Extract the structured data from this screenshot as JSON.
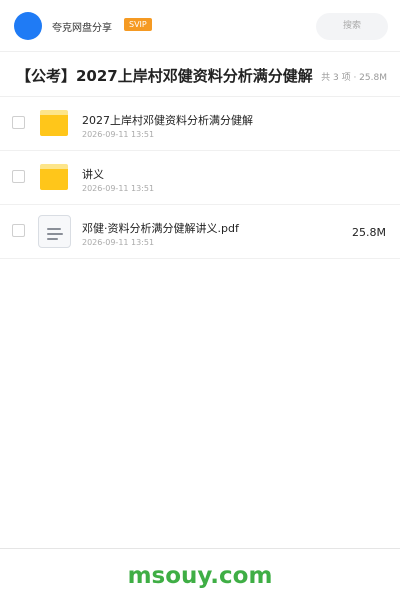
{
  "header": {
    "app_name": "夸克网盘分享",
    "badge": "SVIP",
    "search_placeholder": "搜索",
    "avatar_color": "#1f7bf5",
    "badge_color": "#f59a23"
  },
  "share": {
    "title": "【公考】2027上岸村邓健资料分析满分健解",
    "summary": "共 3 项 · 25.8M"
  },
  "files": [
    {
      "icon": "folder-icon",
      "name": "2027上岸村邓健资料分析满分健解",
      "date": "2026-09-11 13:51",
      "size": ""
    },
    {
      "icon": "folder-icon",
      "name": "讲义",
      "date": "2026-09-11 13:51",
      "size": ""
    },
    {
      "icon": "document-icon",
      "name": "邓健·资料分析满分健解讲义.pdf",
      "date": "2026-09-11 13:51",
      "size": "25.8M"
    }
  ],
  "footer": {
    "watermark": "msouy.com",
    "watermark_color": "#3fae45"
  }
}
